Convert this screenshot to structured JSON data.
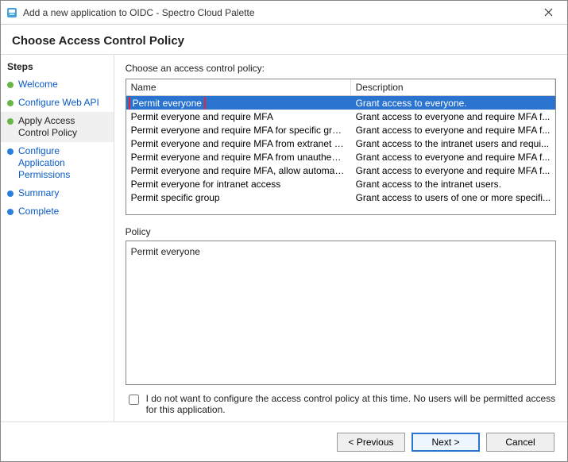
{
  "titlebar": {
    "title": "Add a new application to OIDC - Spectro Cloud Palette"
  },
  "heading": "Choose Access Control Policy",
  "sidebar": {
    "header": "Steps",
    "items": [
      {
        "label": "Welcome"
      },
      {
        "label": "Configure Web API"
      },
      {
        "label": "Apply Access Control Policy"
      },
      {
        "label": "Configure Application Permissions"
      },
      {
        "label": "Summary"
      },
      {
        "label": "Complete"
      }
    ]
  },
  "main": {
    "chooseLabel": "Choose an access control policy:",
    "columns": {
      "name": "Name",
      "description": "Description"
    },
    "rows": [
      {
        "name": "Permit everyone",
        "desc": "Grant access to everyone."
      },
      {
        "name": "Permit everyone and require MFA",
        "desc": "Grant access to everyone and require MFA f..."
      },
      {
        "name": "Permit everyone and require MFA for specific group",
        "desc": "Grant access to everyone and require MFA f..."
      },
      {
        "name": "Permit everyone and require MFA from extranet access",
        "desc": "Grant access to the intranet users and requi..."
      },
      {
        "name": "Permit everyone and require MFA from unauthenticated ...",
        "desc": "Grant access to everyone and require MFA f..."
      },
      {
        "name": "Permit everyone and require MFA, allow automatic devi...",
        "desc": "Grant access to everyone and require MFA f..."
      },
      {
        "name": "Permit everyone for intranet access",
        "desc": "Grant access to the intranet users."
      },
      {
        "name": "Permit specific group",
        "desc": "Grant access to users of one or more specifi..."
      }
    ],
    "policyLabel": "Policy",
    "policyText": "Permit everyone",
    "optOut": "I do not want to configure the access control policy at this time.  No users will be permitted access for this application."
  },
  "footer": {
    "previous": "< Previous",
    "next": "Next >",
    "cancel": "Cancel"
  }
}
